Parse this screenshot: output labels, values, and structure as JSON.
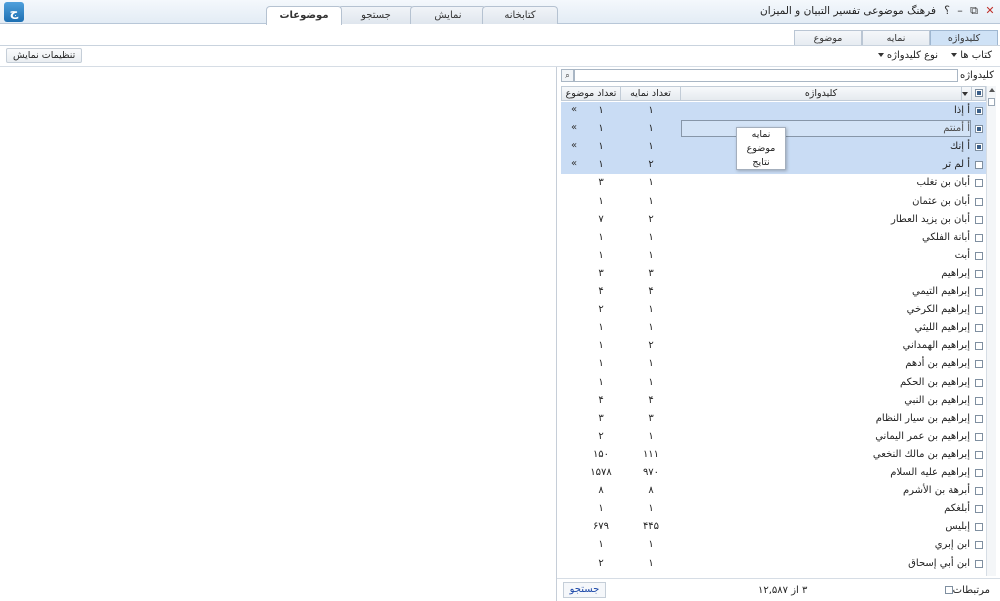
{
  "titlebar": {
    "logo": "ج",
    "title": "فرهنگ موضوعی تفسیر التبیان و المیزان",
    "help": "؟",
    "minimize": "–",
    "restore": "⧉",
    "close": "✕",
    "tabs": [
      {
        "label": "موضوعات",
        "active": true
      },
      {
        "label": "جستجو",
        "active": false
      },
      {
        "label": "نمایش",
        "active": false
      },
      {
        "label": "کتابخانه",
        "active": false
      }
    ]
  },
  "subtabs": [
    {
      "label": "کلیدواژه",
      "active": true
    },
    {
      "label": "نمایه",
      "active": false
    },
    {
      "label": "موضوع",
      "active": false
    }
  ],
  "toolbar": {
    "books": "کتاب ها",
    "keyword_type": "نوع کلیدواژه",
    "display_settings": "تنظیمات نمایش"
  },
  "search": {
    "label": "کلیدواژه",
    "placeholder": "",
    "button_icon": "⌕"
  },
  "table": {
    "columns": {
      "keyword": "کلیدواژه",
      "index_count": "تعداد نمایه",
      "topic_count": "تعداد موضوع"
    },
    "rows": [
      {
        "keyword": "أ إذا",
        "index_count": "١",
        "topic_count": "١",
        "selected": true,
        "checked": true,
        "more": "»"
      },
      {
        "keyword": "أ أمنتم",
        "index_count": "١",
        "topic_count": "١",
        "selected": true,
        "checked": true,
        "more": "»"
      },
      {
        "keyword": "أ إنك",
        "index_count": "١",
        "topic_count": "١",
        "selected": true,
        "checked": true,
        "more": "»"
      },
      {
        "keyword": "أ لم تر",
        "index_count": "٢",
        "topic_count": "١",
        "selected": true,
        "checked": false,
        "more": "»"
      },
      {
        "keyword": "أبان بن تغلب",
        "index_count": "١",
        "topic_count": "٣",
        "selected": false,
        "checked": false,
        "more": ""
      },
      {
        "keyword": "أبان بن عثمان",
        "index_count": "١",
        "topic_count": "١",
        "selected": false,
        "checked": false,
        "more": ""
      },
      {
        "keyword": "أبان بن يزيد العطار",
        "index_count": "٢",
        "topic_count": "٧",
        "selected": false,
        "checked": false,
        "more": ""
      },
      {
        "keyword": "أبانة الفلكي",
        "index_count": "١",
        "topic_count": "١",
        "selected": false,
        "checked": false,
        "more": ""
      },
      {
        "keyword": "أبت",
        "index_count": "١",
        "topic_count": "١",
        "selected": false,
        "checked": false,
        "more": ""
      },
      {
        "keyword": "إبراهيم",
        "index_count": "٣",
        "topic_count": "٣",
        "selected": false,
        "checked": false,
        "more": ""
      },
      {
        "keyword": "إبراهيم التيمي",
        "index_count": "۴",
        "topic_count": "۴",
        "selected": false,
        "checked": false,
        "more": ""
      },
      {
        "keyword": "إبراهيم الكرخي",
        "index_count": "١",
        "topic_count": "٢",
        "selected": false,
        "checked": false,
        "more": ""
      },
      {
        "keyword": "إبراهيم الليثي",
        "index_count": "١",
        "topic_count": "١",
        "selected": false,
        "checked": false,
        "more": ""
      },
      {
        "keyword": "إبراهيم الهمداني",
        "index_count": "٢",
        "topic_count": "١",
        "selected": false,
        "checked": false,
        "more": ""
      },
      {
        "keyword": "إبراهيم بن أدهم",
        "index_count": "١",
        "topic_count": "١",
        "selected": false,
        "checked": false,
        "more": ""
      },
      {
        "keyword": "إبراهيم بن الحكم",
        "index_count": "١",
        "topic_count": "١",
        "selected": false,
        "checked": false,
        "more": ""
      },
      {
        "keyword": "إبراهيم بن النبي",
        "index_count": "۴",
        "topic_count": "۴",
        "selected": false,
        "checked": false,
        "more": ""
      },
      {
        "keyword": "إبراهيم بن سيار النظام",
        "index_count": "٣",
        "topic_count": "٣",
        "selected": false,
        "checked": false,
        "more": ""
      },
      {
        "keyword": "إبراهيم بن عمر اليماني",
        "index_count": "١",
        "topic_count": "٢",
        "selected": false,
        "checked": false,
        "more": ""
      },
      {
        "keyword": "إبراهيم بن مالك النخعي",
        "index_count": "١١١",
        "topic_count": "١۵٠",
        "selected": false,
        "checked": false,
        "more": ""
      },
      {
        "keyword": "إبراهيم عليه السلام",
        "index_count": "٩٧٠",
        "topic_count": "١۵٧٨",
        "selected": false,
        "checked": false,
        "more": ""
      },
      {
        "keyword": "أبرهة بن الأشرم",
        "index_count": "٨",
        "topic_count": "٨",
        "selected": false,
        "checked": false,
        "more": ""
      },
      {
        "keyword": "أبلغكم",
        "index_count": "١",
        "topic_count": "١",
        "selected": false,
        "checked": false,
        "more": ""
      },
      {
        "keyword": "إبليس",
        "index_count": "۴۴۵",
        "topic_count": "۶٧٩",
        "selected": false,
        "checked": false,
        "more": ""
      },
      {
        "keyword": "ابن إبري",
        "index_count": "١",
        "topic_count": "١",
        "selected": false,
        "checked": false,
        "more": ""
      },
      {
        "keyword": "ابن أبي إسحاق",
        "index_count": "١",
        "topic_count": "٢",
        "selected": false,
        "checked": false,
        "more": ""
      }
    ]
  },
  "context_menu": {
    "items": [
      "نمایه",
      "موضوع",
      "نتایج"
    ]
  },
  "footer": {
    "related": "مرتبطات",
    "count": "٣ از ١٢,۵٨٧",
    "search_button": "جستجو"
  }
}
